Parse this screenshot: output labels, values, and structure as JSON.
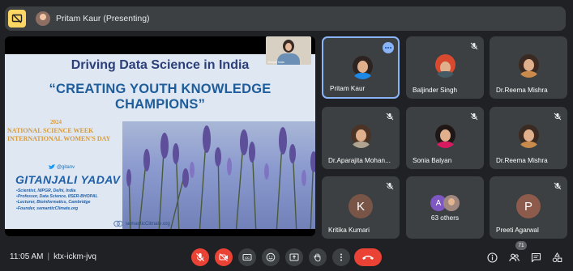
{
  "topbar": {
    "presenter_label": "Pritam Kaur (Presenting)"
  },
  "slide": {
    "title": "Driving Data Science in India",
    "subtitle": "“CREATING YOUTH KNOWLEDGE CHAMPIONS”",
    "year": "2024",
    "event_line1": "NATIONAL SCIENCE WEEK",
    "event_line2": "INTERNATIONAL WOMEN'S DAY",
    "twitter_handle": "@gitanv",
    "speaker_name": "GITANJALI YADAV",
    "bullets": [
      "Scientist, NIPGR, Delhi, India",
      "Professor, Data Science, IISER-BHOPAL",
      "Lecturer, Bioinformatics, Cambridge",
      "Founder, semanticClimate.org"
    ],
    "brand": "semanticClimate.org",
    "pip_caption": "Gitanjali Yadav"
  },
  "participants": [
    {
      "name": "Pritam Kaur",
      "muted": false,
      "active": true
    },
    {
      "name": "Baljinder Singh",
      "muted": true
    },
    {
      "name": "Dr.Reema Mishra",
      "muted": false
    },
    {
      "name": "Dr.Aparajita Mohan...",
      "muted": true
    },
    {
      "name": "Sonia Balyan",
      "muted": true
    },
    {
      "name": "Dr.Reema Mishra",
      "muted": true
    },
    {
      "name": "Kritika Kumari",
      "muted": true,
      "initial": "K"
    },
    {
      "name": "63 others",
      "initial": "A"
    },
    {
      "name": "Preeti Agarwal",
      "muted": true,
      "initial": "P"
    }
  ],
  "bottombar": {
    "time": "11:05 AM",
    "meeting_code": "ktx-ickm-jvq",
    "people_count": "71"
  },
  "colors": {
    "background": "#202124",
    "tile": "#3c4043",
    "active_border": "#8ab4f8",
    "end_call": "#ea4335",
    "presenting_icon": "#fdd663"
  }
}
